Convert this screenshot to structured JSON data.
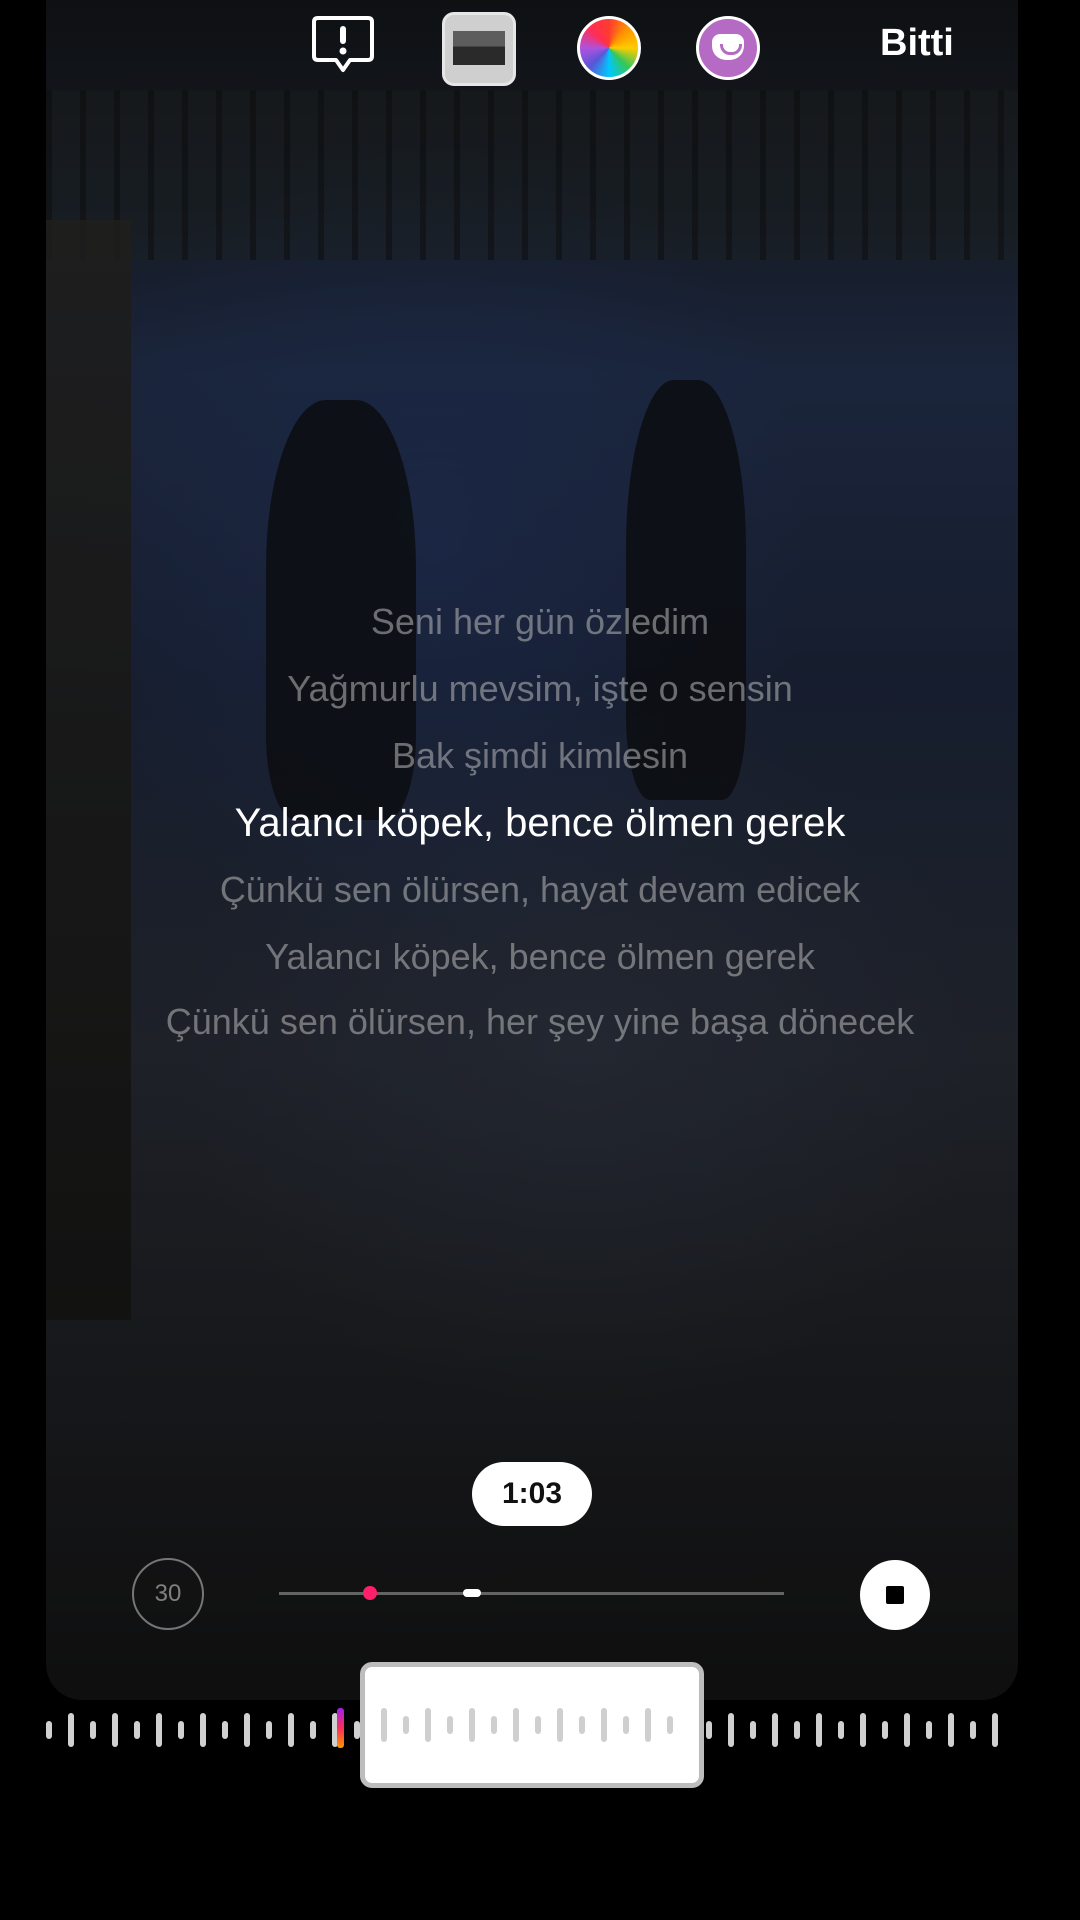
{
  "toolbar": {
    "alert_icon": "alert-bubble-icon",
    "image_icon": "image-thumbnail-icon",
    "color_icon": "color-wheel-icon",
    "sticker_icon": "sticker-face-icon",
    "done_label": "Bitti"
  },
  "lyrics": [
    {
      "text": "Seni her gün özledim",
      "active": false
    },
    {
      "text": "Yağmurlu mevsim, işte o sensin",
      "active": false
    },
    {
      "text": "Bak şimdi kimlesin",
      "active": false
    },
    {
      "text": "Yalancı köpek, bence ölmen gerek",
      "active": true
    },
    {
      "text": "Çünkü sen ölürsen, hayat devam edicek",
      "active": false
    },
    {
      "text": "Yalancı köpek, bence ölmen gerek",
      "active": false
    },
    {
      "text": "Çünkü sen ölürsen, her şey yine başa dönecek",
      "active": false
    }
  ],
  "player": {
    "time_label": "1:03",
    "duration_label": "30",
    "stop_icon": "stop-icon"
  },
  "colors": {
    "accent": "#ff1f6a",
    "active_lyric": "#ffffff",
    "inactive_lyric": "#b9b9b9"
  }
}
